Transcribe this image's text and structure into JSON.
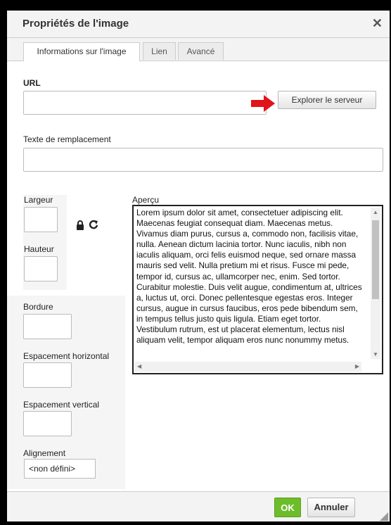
{
  "dialog": {
    "title": "Propriétés de l'image",
    "close_symbol": "✕",
    "tabs": [
      {
        "label": "Informations sur l'image",
        "active": true
      },
      {
        "label": "Lien",
        "active": false
      },
      {
        "label": "Avancé",
        "active": false
      }
    ]
  },
  "form": {
    "url_label": "URL",
    "url_value": "",
    "browse_button": "Explorer le serveur",
    "alt_label": "Texte de remplacement",
    "alt_value": "",
    "width_label": "Largeur",
    "height_label": "Hauteur",
    "border_label": "Bordure",
    "hspace_label": "Espacement horizontal",
    "vspace_label": "Espacement vertical",
    "align_label": "Alignement",
    "align_value": "<non défini>",
    "lock_icon": "lock-icon",
    "reset_icon": "refresh-icon"
  },
  "preview": {
    "label": "Aperçu",
    "text": "Lorem ipsum dolor sit amet, consectetuer adipiscing elit. Maecenas feugiat consequat diam. Maecenas metus. Vivamus diam purus, cursus a, commodo non, facilisis vitae, nulla. Aenean dictum lacinia tortor. Nunc iaculis, nibh non iaculis aliquam, orci felis euismod neque, sed ornare massa mauris sed velit. Nulla pretium mi et risus. Fusce mi pede, tempor id, cursus ac, ullamcorper nec, enim. Sed tortor. Curabitur molestie. Duis velit augue, condimentum at, ultrices a, luctus ut, orci. Donec pellentesque egestas eros. Integer cursus, augue in cursus faucibus, eros pede bibendum sem, in tempus tellus justo quis ligula. Etiam eget tortor. Vestibulum rutrum, est ut placerat elementum, lectus nisl aliquam velit, tempor aliquam eros nunc nonummy metus."
  },
  "footer": {
    "ok_label": "OK",
    "cancel_label": "Annuler"
  },
  "colors": {
    "ok_green": "#6dbd2a",
    "arrow_red": "#e0141a"
  }
}
